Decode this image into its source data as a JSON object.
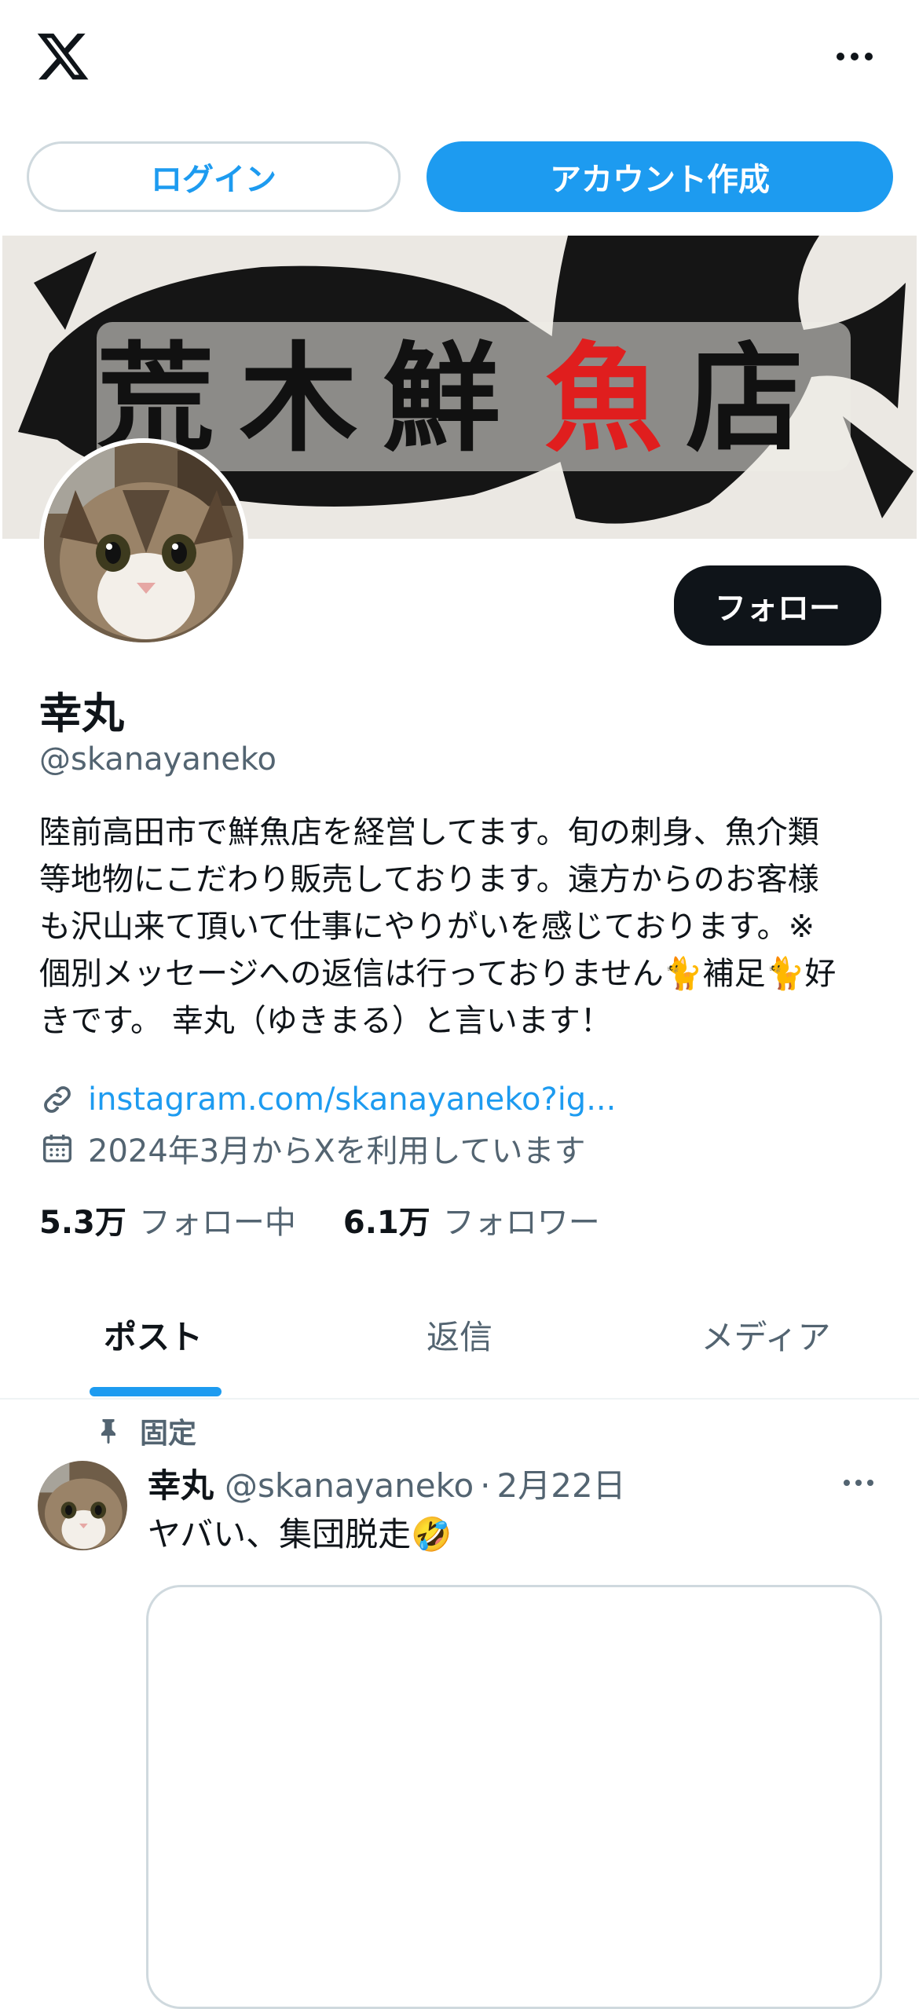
{
  "top_bar": {
    "logo_icon": "x-logo-icon",
    "more_icon": "more-horizontal-icon"
  },
  "auth": {
    "login_label": "ログイン",
    "signup_label": "アカウント作成"
  },
  "banner": {
    "text_left": "荒木鮮",
    "text_red": "魚",
    "text_right": "店"
  },
  "profile": {
    "follow_label": "フォロー",
    "display_name": "幸丸",
    "handle": "@skanayaneko",
    "bio": "陸前高田市で鮮魚店を経営してます。旬の刺身、魚介類\n等地物にこだわり販売しております。遠方からのお客様\nも沢山来て頂いて仕事にやりがいを感じております。※\n個別メッセージへの返信は行っておりません🐈補足🐈好\nきです。 幸丸（ゆきまる）と言います！",
    "link": "instagram.com/skanayaneko?ig...",
    "joined": "2024年3月からXを利用しています",
    "following_count": "5.3万",
    "following_label": "フォロー中",
    "followers_count": "6.1万",
    "followers_label": "フォロワー"
  },
  "tabs": [
    {
      "label": "ポスト",
      "selected": true
    },
    {
      "label": "返信",
      "selected": false
    },
    {
      "label": "メディア",
      "selected": false
    }
  ],
  "pinned_post": {
    "pinned_label": "固定",
    "author_name": "幸丸",
    "author_handle": "@skanayaneko",
    "separator": "·",
    "date": "2月22日",
    "text": "ヤバい、集団脱走🤣"
  },
  "colors": {
    "accent": "#1d9bf0",
    "text": "#0f1419",
    "secondary_text": "#536471",
    "border": "#cfd9de"
  }
}
